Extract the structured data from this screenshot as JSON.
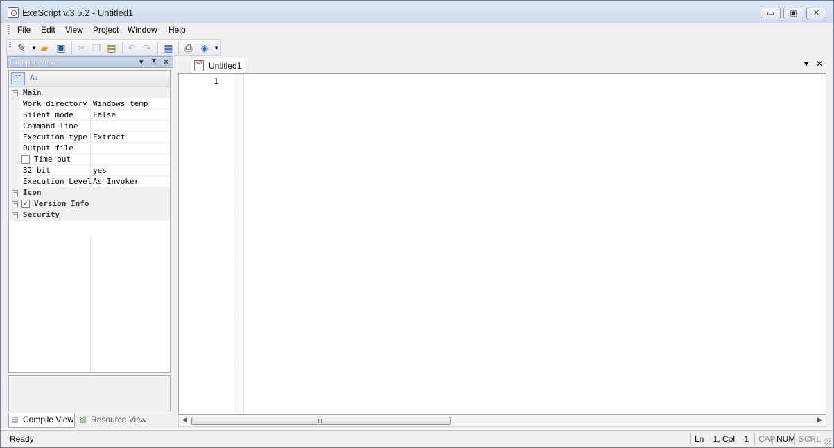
{
  "window": {
    "title": "ExeScript v.3.5.2 - Untitled1",
    "controls": {
      "minimize": "▭",
      "restore": "▣",
      "close": "✕"
    }
  },
  "menu": [
    "File",
    "Edit",
    "View",
    "Project",
    "Window",
    "Help"
  ],
  "toolbar": {
    "icons": [
      "new-icon",
      "open-icon",
      "save-icon",
      "cut-icon",
      "copy-icon",
      "paste-icon",
      "undo-icon",
      "redo-icon",
      "compile-icon",
      "print-icon",
      "run-icon",
      "overflow-icon"
    ]
  },
  "compile_panel": {
    "title": "Compile View",
    "header_controls": {
      "dropdown": "▾",
      "pin": "⊼",
      "close": "✕"
    },
    "categories": {
      "main": "Main",
      "icon": "Icon",
      "version_info": "Version Info",
      "security": "Security"
    },
    "properties": [
      {
        "name": "Work directory",
        "value": "Windows temp"
      },
      {
        "name": "Silent mode",
        "value": "False"
      },
      {
        "name": "Command line",
        "value": ""
      },
      {
        "name": "Execution type",
        "value": "Extract"
      },
      {
        "name": "Output file",
        "value": ""
      },
      {
        "name": "Time out",
        "value": ""
      },
      {
        "name": "32 bit",
        "value": "yes"
      },
      {
        "name": "Execution Level",
        "value": "As Invoker"
      }
    ],
    "time_out_checked": false,
    "version_info_checked": true,
    "tabs": {
      "compile": "Compile View",
      "resource": "Resource View"
    }
  },
  "editor": {
    "tab_label": "Untitled1",
    "tab_icon_text": "BAT",
    "tab_controls": {
      "dropdown": "▾",
      "close": "✕"
    },
    "line_numbers": [
      "1"
    ]
  },
  "statusbar": {
    "status": "Ready",
    "position": "Ln    1, Col    1",
    "indicators": {
      "cap": "CAP",
      "num": "NUM",
      "scrl": "SCRL"
    }
  }
}
